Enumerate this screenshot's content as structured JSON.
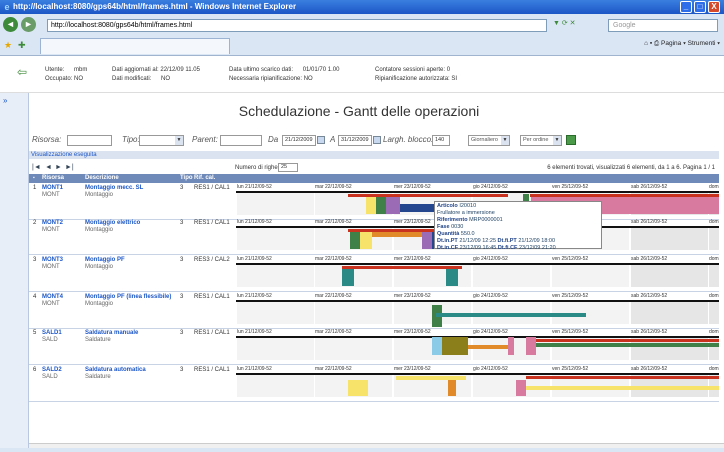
{
  "window": {
    "title": "http://localhost:8080/gps64b/html/frames.html - Windows Internet Explorer",
    "minimize": "_",
    "maximize": "□",
    "close": "X"
  },
  "address": {
    "url": "http://localhost:8080/gps64b/html/frames.html",
    "search_placeholder": "Google"
  },
  "tools": {
    "page": "Pagina",
    "tools": "Strumenti"
  },
  "info": {
    "user_label": "Utente:",
    "user_value": "mbm",
    "busy_label": "Occupato:",
    "busy_value": "NO",
    "updated_label": "Dati aggiornati al:",
    "updated_value": "22/12/09 11.05",
    "modified_label": "Dati modificati:",
    "modified_value": "NO",
    "last_download_label": "Data ultimo scarico dati:",
    "last_download_value": "01/01/70 1.00",
    "replan_label": "Necessaria ripianificazione:",
    "replan_value": "NO",
    "sessions_label": "Contatore sessioni aperte:",
    "sessions_value": "0",
    "replan_auth_label": "Ripianificazione autorizzata:",
    "replan_auth_value": "SI"
  },
  "page": {
    "title": "Schedulazione - Gantt delle operazioni"
  },
  "filters": {
    "risorsa": "Risorsa:",
    "tipo": "Tipo:",
    "parent": "Parent:",
    "da": "Da",
    "da_value": "21/12/2009",
    "a": "A",
    "a_value": "31/12/2009",
    "largh": "Largh. blocco:",
    "largh_value": "140",
    "view": "Giornaliero",
    "order": "Per ordine"
  },
  "section": "Visualizzazione eseguita",
  "nav": {
    "rows_label": "Numero di righe",
    "rows_value": "25",
    "summary": "6 elementi trovati, visualizzati 6 elementi, da 1 a 6. Pagina 1 / 1"
  },
  "columns": {
    "risorsa": "Risorsa",
    "descrizione": "Descrizione",
    "tipo": "Tipo",
    "rifcal": "Rif. cal."
  },
  "days": [
    "lun 21/12/09-52",
    "mar 22/12/09-52",
    "mer 23/12/09-52",
    "gio 24/12/09-52",
    "ven 25/12/09-52",
    "sab 26/12/09-52",
    "dom 2"
  ],
  "rows": [
    {
      "num": "1",
      "code": "MONT1",
      "group": "MONT",
      "desc": "Montaggio mecc. SL",
      "sub": "Montaggio",
      "tipo": "3",
      "cal": "RES1 / CAL1"
    },
    {
      "num": "2",
      "code": "MONT2",
      "group": "MONT",
      "desc": "Montaggio elettrico",
      "sub": "Montaggio",
      "tipo": "3",
      "cal": "RES1 / CAL1"
    },
    {
      "num": "3",
      "code": "MONT3",
      "group": "MONT",
      "desc": "Montaggio PF",
      "sub": "Montaggio",
      "tipo": "3",
      "cal": "RES3 / CAL2"
    },
    {
      "num": "4",
      "code": "MONT4",
      "group": "MONT",
      "desc": "Montaggio PF (linea flessibile)",
      "sub": "Montaggio",
      "tipo": "3",
      "cal": "RES1 / CAL1"
    },
    {
      "num": "5",
      "code": "SALD1",
      "group": "SALD",
      "desc": "Saldatura manuale",
      "sub": "Saldature",
      "tipo": "3",
      "cal": "RES1 / CAL1"
    },
    {
      "num": "6",
      "code": "SALD2",
      "group": "SALD",
      "desc": "Saldatura automatica",
      "sub": "Saldature",
      "tipo": "3",
      "cal": "RES1 / CAL1"
    }
  ],
  "tooltip": {
    "articolo_label": "Articolo",
    "articolo": "I20010",
    "articolo_desc": "Frullatore a immersione",
    "rif_label": "Riferimento",
    "rif": "MRP0000001",
    "fase_label": "Fase",
    "fase": "0030",
    "qta_label": "Quantità",
    "qta": "550.0",
    "dtinpt_label": "Dt.in.PT",
    "dtinpt": "21/12/09 12:25",
    "dtfipt_label": "Dt.fi.PT",
    "dtfipt": "21/12/09 18:00",
    "dtincf_label": "Dt.in.CF",
    "dtincf": "23/12/09 16:45",
    "dtficf_label": "Dt.fi.CF",
    "dtficf": "23/12/09 21:20"
  },
  "colors": {
    "red": "#c8321e",
    "green": "#3f7f48",
    "yellow": "#f7e36a",
    "purple": "#9b6bb5",
    "navy": "#23468f",
    "teal": "#2a8a85",
    "orange": "#e08a2a",
    "olive": "#8a7f1a",
    "pink": "#d87aa0",
    "lightblue": "#8ccbe8"
  }
}
